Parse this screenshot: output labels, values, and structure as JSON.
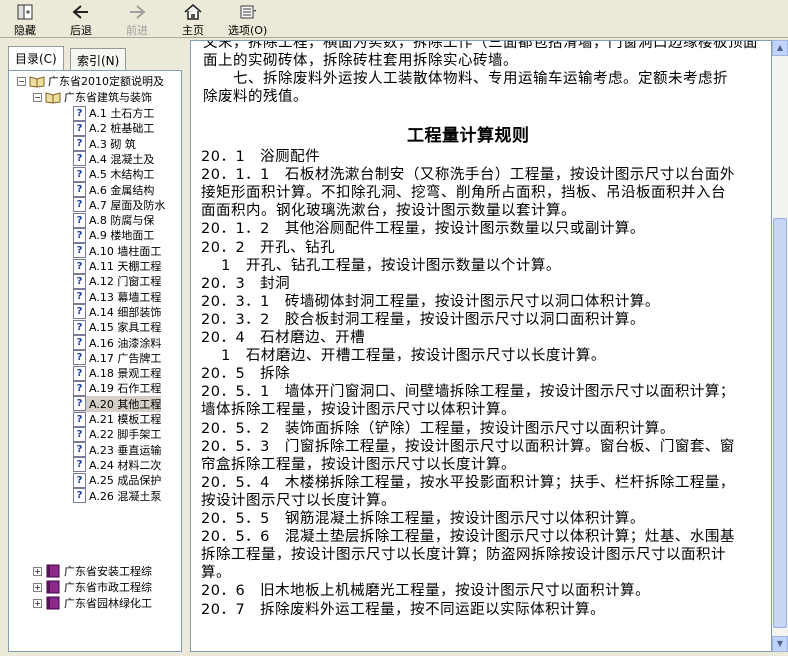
{
  "toolbar": {
    "hide": "隐藏",
    "back": "后退",
    "forward": "前进",
    "home": "主页",
    "options": "选项(O)"
  },
  "tabs": {
    "contents": "目录(C)",
    "index": "索引(N)"
  },
  "tree": {
    "root": "广东省2010定额说明及",
    "sub": "广东省建筑与装饰",
    "items": [
      "A.1 土石方工",
      "A.2 桩基础工",
      "A.3 砌 筑",
      "A.4 混凝土及",
      "A.5 木结构工",
      "A.6 金属结构",
      "A.7 屋面及防水",
      "A.8 防腐与保",
      "A.9 楼地面工",
      "A.10 墙柱面工",
      "A.11 天棚工程",
      "A.12 门窗工程",
      "A.13 幕墙工程",
      "A.14 细部装饰",
      "A.15 家具工程",
      "A.16 油漆涂料",
      "A.17 广告牌工",
      "A.18 景观工程",
      "A.19 石作工程",
      "A.20 其他工程",
      "A.21 模板工程",
      "A.22 脚手架工",
      "A.23 垂直运输",
      "A.24 材料二次",
      "A.25 成品保护",
      "A.26 混凝土泵"
    ],
    "others": [
      "广东省安装工程综",
      "广东省市政工程综",
      "广东省园林绿化工"
    ]
  },
  "content": {
    "top_lines": [
      "文末，拆除工程，横面为实数，拆除工作（三面都包括滑墙，门窗洞口边缘楼板顶面",
      "面上的实砌砖体，拆除砖柱套用拆除实心砖墙。",
      "　　七、拆除废料外运按人工装散体物料、专用运输车运输考虑。定额未考虑折",
      "除废料的残值。"
    ],
    "heading": "工程量计算规则",
    "lines": [
      "20．1　浴厕配件",
      "20．1．1　石板材洗漱台制安（又称洗手台）工程量，按设计图示尺寸以台面外",
      "接矩形面积计算。不扣除孔洞、挖弯、削角所占面积，挡板、吊沿板面积并入台",
      "面面积内。钢化玻璃洗漱台，按设计图示数量以套计算。",
      "20．1．2　其他浴厕配件工程量，按设计图示数量以只或副计算。",
      "20．2　开孔、钻孔",
      "　 1　开孔、钻孔工程量，按设计图示数量以个计算。",
      "20．3　封洞",
      "20．3．1　砖墙砌体封洞工程量，按设计图示尺寸以洞口体积计算。",
      "20．3．2　胶合板封洞工程量，按设计图示尺寸以洞口面积计算。",
      "20．4　石材磨边、开槽",
      "　 1　石材磨边、开槽工程量，按设计图示尺寸以长度计算。",
      "20．5　拆除",
      "20．5．1　墙体开门窗洞口、间壁墙拆除工程量，按设计图示尺寸以面积计算；",
      "墙体拆除工程量，按设计图示尺寸以体积计算。",
      "20．5．2　装饰面拆除（铲除）工程量，按设计图示尺寸以面积计算。",
      "20．5．3　门窗拆除工程量，按设计图示尺寸以面积计算。窗台板、门窗套、窗",
      "帘盒拆除工程量，按设计图示尺寸以长度计算。",
      "20．5．4　木楼梯拆除工程量，按水平投影面积计算；扶手、栏杆拆除工程量，",
      "按设计图示尺寸以长度计算。",
      "20．5．5　钢筋混凝土拆除工程量，按设计图示尺寸以体积计算。",
      "20．5．6　混凝土垫层拆除工程量，按设计图示尺寸以体积计算；灶基、水围基",
      "拆除工程量，按设计图示尺寸以长度计算；防盗网拆除按设计图示尺寸以面积计",
      "算。",
      "20．6　旧木地板上机械磨光工程量，按设计图示尺寸以面积计算。",
      "20．7　拆除废料外运工程量，按不同运距以实际体积计算。"
    ]
  },
  "icons": [
    "hide-icon",
    "back-icon",
    "forward-icon",
    "home-icon",
    "options-icon",
    "book-icon",
    "help-page-icon"
  ],
  "colors": {
    "toolbar": "#ece9d8",
    "tree_border": "#7f9db9",
    "selected": "#d4d0c8"
  }
}
